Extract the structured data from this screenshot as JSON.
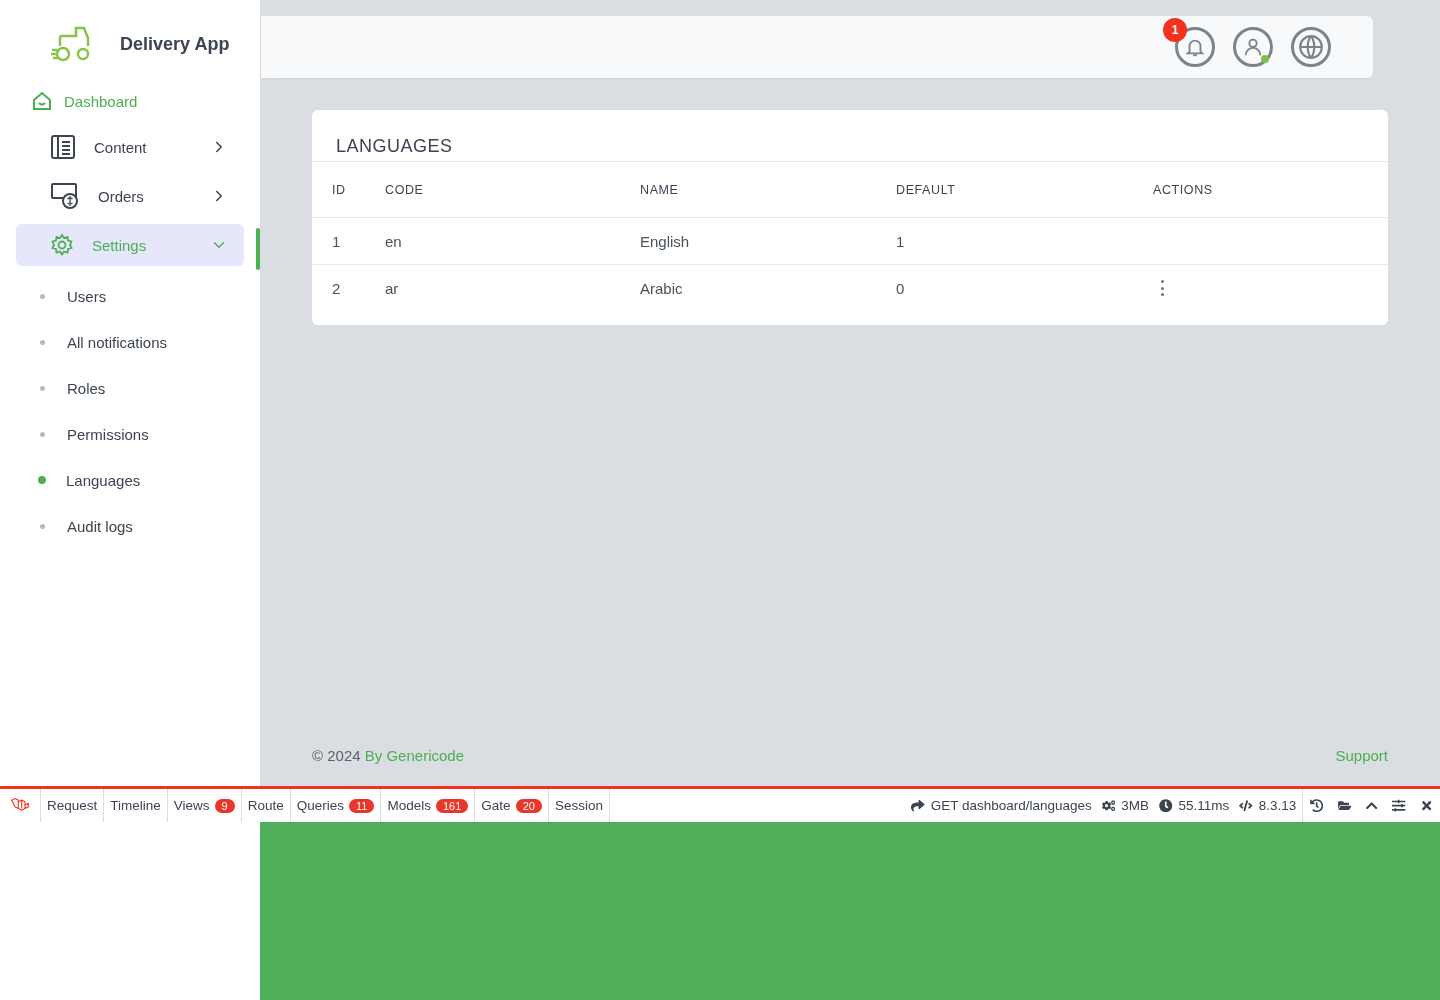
{
  "brand": {
    "name": "Delivery App"
  },
  "sidebar": {
    "items": [
      {
        "label": "Dashboard",
        "kind": "link",
        "selected": false
      },
      {
        "label": "Content",
        "kind": "group",
        "selected": false,
        "expanded": false
      },
      {
        "label": "Orders",
        "kind": "group",
        "selected": false,
        "expanded": false
      },
      {
        "label": "Settings",
        "kind": "group",
        "selected": true,
        "expanded": true,
        "children": [
          {
            "label": "Users",
            "selected": false
          },
          {
            "label": "All notifications",
            "selected": false
          },
          {
            "label": "Roles",
            "selected": false
          },
          {
            "label": "Permissions",
            "selected": false
          },
          {
            "label": "Languages",
            "selected": true
          },
          {
            "label": "Audit logs",
            "selected": false
          }
        ]
      }
    ]
  },
  "header": {
    "notification_count": "1",
    "user_online": true
  },
  "table": {
    "title": "LANGUAGES",
    "columns": [
      "ID",
      "CODE",
      "NAME",
      "DEFAULT",
      "ACTIONS"
    ],
    "rows": [
      {
        "cells": [
          "1",
          "en",
          "English",
          "1"
        ],
        "actions_menu": false
      },
      {
        "cells": [
          "2",
          "ar",
          "Arabic",
          "0"
        ],
        "actions_menu": true
      }
    ]
  },
  "footer": {
    "copyright": "© 2024",
    "author": "By Genericode",
    "support": "Support"
  },
  "debugbar": {
    "tabs": [
      {
        "label": "Request"
      },
      {
        "label": "Timeline"
      },
      {
        "label": "Views",
        "count": "9"
      },
      {
        "label": "Route"
      },
      {
        "label": "Queries",
        "count": "11"
      },
      {
        "label": "Models",
        "count": "161"
      },
      {
        "label": "Gate",
        "count": "20"
      },
      {
        "label": "Session"
      }
    ],
    "request": "GET dashboard/languages",
    "memory": "3MB",
    "time": "55.11ms",
    "version": "8.3.13"
  }
}
